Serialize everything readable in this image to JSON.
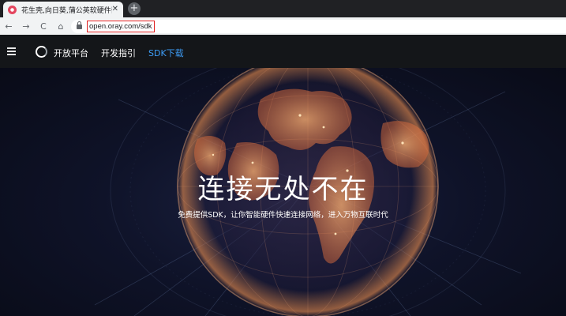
{
  "browser": {
    "tab_title": "花生壳,向日葵,蒲公英软硬件嵌入",
    "tab_close": "✕",
    "new_tab": "+",
    "url": "open.oray.com/sdk",
    "back": "←",
    "forward": "→",
    "reload": "C",
    "home": "⌂"
  },
  "header": {
    "brand": "开放平台",
    "nav": [
      {
        "label": "开发指引"
      },
      {
        "label": "SDK下载"
      }
    ],
    "active_color": "#3d9cf5"
  },
  "hero": {
    "title": "连接无处不在",
    "subtitle": "免费提供SDK，让你智能硬件快速连接网络，进入万物互联时代"
  }
}
